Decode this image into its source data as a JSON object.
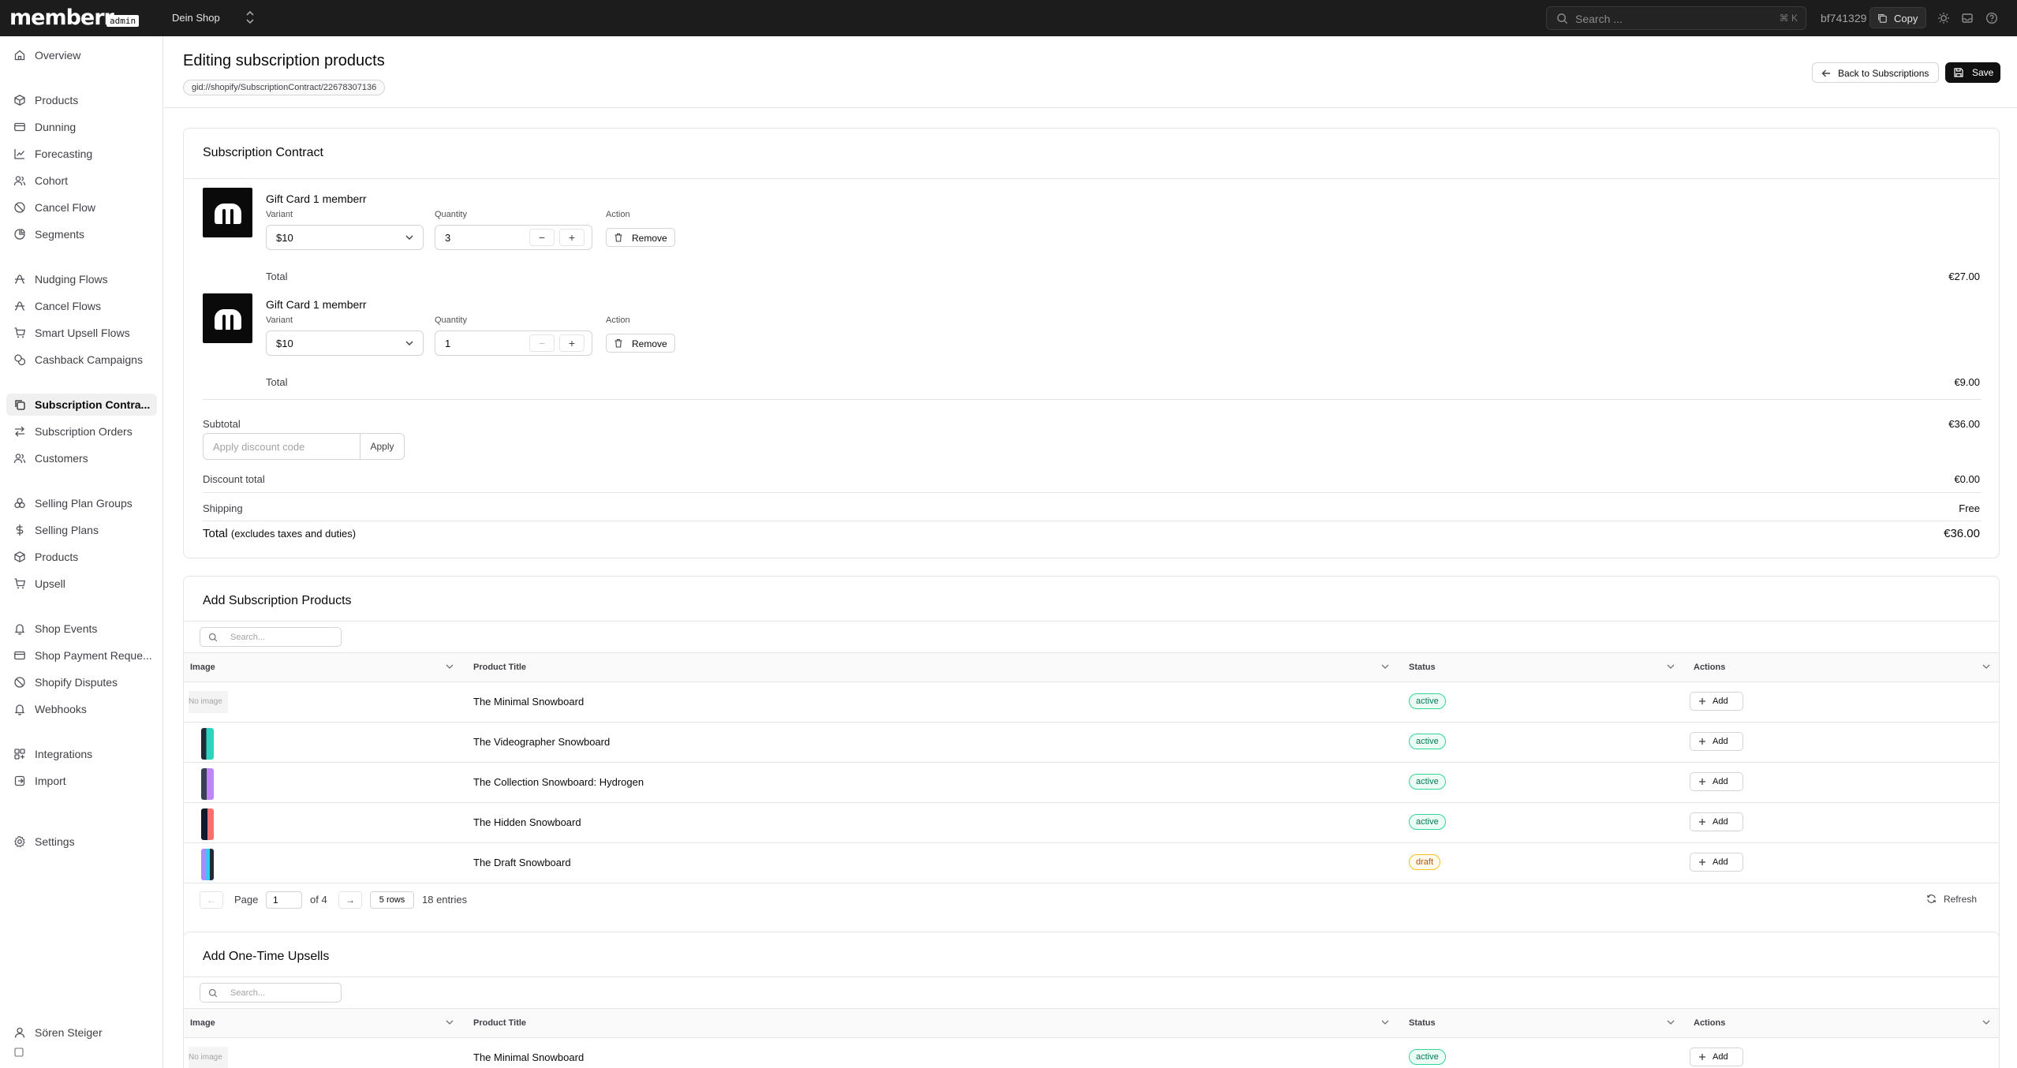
{
  "topbar": {
    "logo": "memberr",
    "logo_badge": "admin",
    "shop": "Dein Shop",
    "search_placeholder": "Search ...",
    "search_shortcut": "⌘ K",
    "user_id": "bf741329",
    "copy_label": "Copy"
  },
  "sidebar": {
    "items": [
      {
        "label": "Overview",
        "icon": "home-icon"
      },
      {
        "label": "Products",
        "icon": "package-icon"
      },
      {
        "label": "Dunning",
        "icon": "credit-card-icon"
      },
      {
        "label": "Forecasting",
        "icon": "line-chart-icon"
      },
      {
        "label": "Cohort",
        "icon": "users-icon"
      },
      {
        "label": "Cancel Flow",
        "icon": "ban-icon"
      },
      {
        "label": "Segments",
        "icon": "pie-chart-icon"
      },
      {
        "label": "Nudging Flows",
        "icon": "workflow-icon"
      },
      {
        "label": "Cancel Flows",
        "icon": "workflow-icon"
      },
      {
        "label": "Smart Upsell Flows",
        "icon": "cart-icon"
      },
      {
        "label": "Cashback Campaigns",
        "icon": "coins-icon"
      },
      {
        "label": "Subscription Contra...",
        "icon": "copy-icon"
      },
      {
        "label": "Subscription Orders",
        "icon": "arrows-icon"
      },
      {
        "label": "Customers",
        "icon": "users-icon"
      },
      {
        "label": "Selling Plan Groups",
        "icon": "group-icon"
      },
      {
        "label": "Selling Plans",
        "icon": "dollar-icon"
      },
      {
        "label": "Products",
        "icon": "package-icon"
      },
      {
        "label": "Upsell",
        "icon": "cart-icon"
      },
      {
        "label": "Shop Events",
        "icon": "bell-icon"
      },
      {
        "label": "Shop Payment Reque...",
        "icon": "credit-card-icon"
      },
      {
        "label": "Shopify Disputes",
        "icon": "ban-icon"
      },
      {
        "label": "Webhooks",
        "icon": "bell-icon"
      },
      {
        "label": "Integrations",
        "icon": "grid-icon"
      },
      {
        "label": "Import",
        "icon": "import-icon"
      },
      {
        "label": "Settings",
        "icon": "gear-icon"
      }
    ],
    "user_name": "Sören Steiger"
  },
  "header": {
    "title": "Editing subscription products",
    "gid": "gid://shopify/SubscriptionContract/22678307136",
    "back_label": "Back to Subscriptions",
    "save_label": "Save"
  },
  "contract": {
    "title": "Subscription Contract",
    "variant_label": "Variant",
    "quantity_label": "Quantity",
    "action_label": "Action",
    "remove_label": "Remove",
    "total_label": "Total",
    "lines": [
      {
        "name": "Gift Card 1 memberr",
        "variant": "$10",
        "quantity": "3",
        "total": "€27.00"
      },
      {
        "name": "Gift Card 1 memberr",
        "variant": "$10",
        "quantity": "1",
        "total": "€9.00"
      }
    ],
    "subtotal_label": "Subtotal",
    "subtotal": "€36.00",
    "discount_placeholder": "Apply discount code",
    "apply_label": "Apply",
    "discount_total_label": "Discount total",
    "discount_total": "€0.00",
    "shipping_label": "Shipping",
    "shipping": "Free",
    "grand_total_label": "Total",
    "grand_total_note": "(excludes taxes and duties)",
    "grand_total": "€36.00"
  },
  "subscription_products": {
    "title": "Add Subscription Products",
    "search_placeholder": "Search...",
    "columns": [
      "Image",
      "Product Title",
      "Status",
      "Actions"
    ],
    "rows": [
      {
        "image": "No image",
        "title": "The Minimal Snowboard",
        "status": "active"
      },
      {
        "image": "",
        "title": "The Videographer Snowboard",
        "status": "active"
      },
      {
        "image": "",
        "title": "The Collection Snowboard: Hydrogen",
        "status": "active"
      },
      {
        "image": "",
        "title": "The Hidden Snowboard",
        "status": "active"
      },
      {
        "image": "",
        "title": "The Draft Snowboard",
        "status": "draft"
      }
    ],
    "add_label": "Add",
    "pager": {
      "page_label": "Page",
      "page": "1",
      "of_label": "of 4",
      "rows_label": "5 rows",
      "entries": "18 entries",
      "refresh_label": "Refresh"
    }
  },
  "upsells": {
    "title": "Add One-Time Upsells",
    "search_placeholder": "Search...",
    "columns": [
      "Image",
      "Product Title",
      "Status",
      "Actions"
    ],
    "rows": [
      {
        "image": "No image",
        "title": "The Minimal Snowboard",
        "status": "active"
      }
    ],
    "add_label": "Add"
  }
}
